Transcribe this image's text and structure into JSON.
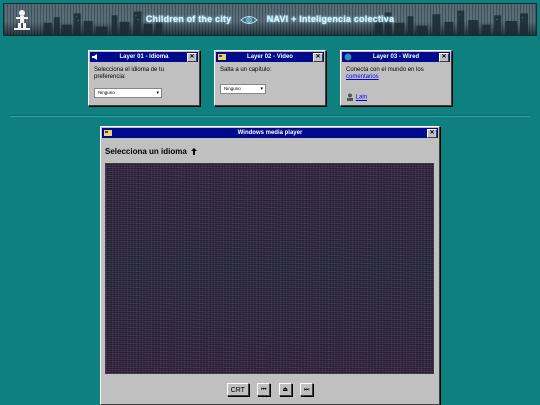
{
  "banner": {
    "title_left": "Children of the city",
    "title_right": "NAVI + Inteligencia colectiva"
  },
  "layers": [
    {
      "title": "Layer 01 - Idioma",
      "icon": "speaker-icon",
      "text": "Selecciona el idioma de tu preferencia:",
      "select_value": "Ninguno"
    },
    {
      "title": "Layer 02 - Video",
      "icon": "video-icon",
      "text": "Salta a un capítulo:",
      "select_value": "Ninguno"
    },
    {
      "title": "Layer 03 - Wired",
      "icon": "globe-icon",
      "text_before": "Conecta con el mundo en los",
      "link_text": "comentarios",
      "user_link": "Lain"
    }
  ],
  "player": {
    "title": "Windows media player",
    "heading": "Selecciona un idioma",
    "buttons": {
      "crt": "CRT",
      "prev": "⏮",
      "eject": "⏏",
      "next": "⏭"
    }
  },
  "colors": {
    "background": "#0f8080",
    "titlebar": "#000a8c",
    "window": "#c0c0c0"
  }
}
